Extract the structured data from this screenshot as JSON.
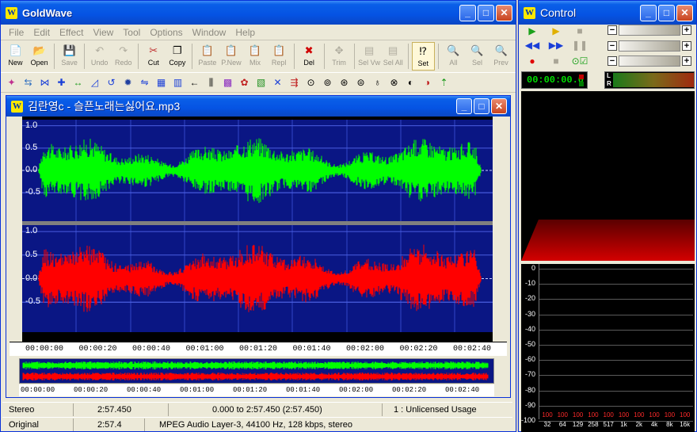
{
  "main": {
    "title": "GoldWave",
    "menu": [
      "File",
      "Edit",
      "Effect",
      "View",
      "Tool",
      "Options",
      "Window",
      "Help"
    ],
    "toolbar": [
      {
        "label": "New",
        "icon": "new-file-icon",
        "glyph": "📄",
        "enabled": true
      },
      {
        "label": "Open",
        "icon": "open-folder-icon",
        "glyph": "📂",
        "enabled": true
      },
      {
        "label": "Save",
        "icon": "save-disk-icon",
        "glyph": "💾",
        "enabled": false
      },
      {
        "label": "Undo",
        "icon": "undo-icon",
        "glyph": "↶",
        "enabled": false
      },
      {
        "label": "Redo",
        "icon": "redo-icon",
        "glyph": "↷",
        "enabled": false
      },
      {
        "label": "Cut",
        "icon": "cut-scissors-icon",
        "glyph": "✂",
        "enabled": true
      },
      {
        "label": "Copy",
        "icon": "copy-icon",
        "glyph": "❐",
        "enabled": true
      },
      {
        "label": "Paste",
        "icon": "paste-icon",
        "glyph": "📋",
        "enabled": false
      },
      {
        "label": "P.New",
        "icon": "paste-new-icon",
        "glyph": "📋",
        "enabled": false
      },
      {
        "label": "Mix",
        "icon": "mix-icon",
        "glyph": "📋",
        "enabled": false
      },
      {
        "label": "Repl",
        "icon": "replace-icon",
        "glyph": "📋",
        "enabled": false
      },
      {
        "label": "Del",
        "icon": "delete-icon",
        "glyph": "✖",
        "enabled": true
      },
      {
        "label": "Trim",
        "icon": "trim-icon",
        "glyph": "✥",
        "enabled": false
      },
      {
        "label": "Sel Vw",
        "icon": "select-view-icon",
        "glyph": "▤",
        "enabled": false
      },
      {
        "label": "Sel All",
        "icon": "select-all-icon",
        "glyph": "▤",
        "enabled": false
      },
      {
        "label": "Set",
        "icon": "set-marker-icon",
        "glyph": "⁉",
        "enabled": true,
        "active": true
      },
      {
        "label": "All",
        "icon": "zoom-all-icon",
        "glyph": "🔍",
        "enabled": false
      },
      {
        "label": "Sel",
        "icon": "zoom-selection-icon",
        "glyph": "🔍",
        "enabled": false
      },
      {
        "label": "Prev",
        "icon": "zoom-previous-icon",
        "glyph": "🔍",
        "enabled": false
      }
    ],
    "effects_toolbar": [
      "✦",
      "⇆",
      "⋈",
      "✚",
      "↔",
      "◿",
      "↺",
      "✹",
      "⇋",
      "▦",
      "▥",
      "←",
      "⫼",
      "▩",
      "✿",
      "▧",
      "✕",
      "⇶",
      "⊙",
      "⊚",
      "⊛",
      "⊜",
      "♁",
      "⊗",
      "◐",
      "◑",
      "⇡"
    ]
  },
  "document": {
    "title": "김란영c - 슬픈노래는싫어요.mp3",
    "y_labels": [
      "1.0",
      "0.5",
      "0.0",
      "-0.5"
    ],
    "time_labels": [
      "00:00:00",
      "00:00:20",
      "00:00:40",
      "00:01:00",
      "00:01:20",
      "00:01:40",
      "00:02:00",
      "00:02:20",
      "00:02:40"
    ],
    "channel_colors": {
      "left": "#00ff00",
      "right": "#ff0000",
      "background": "#0a1684"
    }
  },
  "status": {
    "row1": {
      "channels": "Stereo",
      "length": "2:57.450",
      "selection": "0.000 to 2:57.450 (2:57.450)",
      "license": "1 : Unlicensed Usage"
    },
    "row2": {
      "label": "Original",
      "length": "2:57.4",
      "format": "MPEG Audio Layer-3, 44100 Hz, 128 kbps, stereo"
    }
  },
  "control": {
    "title": "Control",
    "time_readout": "00:00:00.0",
    "level_letters": [
      "L",
      "R"
    ],
    "spectrum_db_labels": [
      "0",
      "-10",
      "-20",
      "-30",
      "-40",
      "-50",
      "-60",
      "-70",
      "-80",
      "-90",
      "-100"
    ],
    "spectrum_freq_labels": [
      "32",
      "64",
      "129",
      "258",
      "517",
      "1k",
      "2k",
      "4k",
      "8k",
      "16k"
    ],
    "peak_labels": [
      "100",
      "100",
      "100",
      "100",
      "100",
      "100",
      "100",
      "100",
      "100",
      "100"
    ]
  }
}
